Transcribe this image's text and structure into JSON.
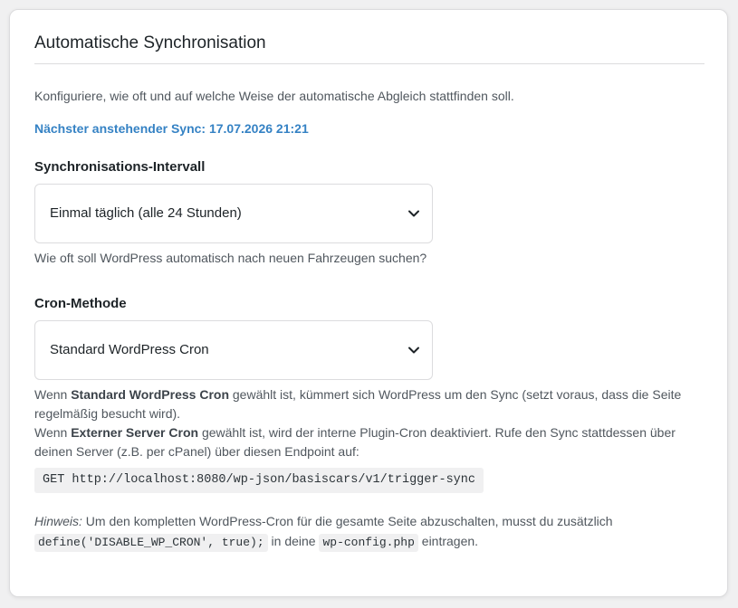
{
  "section": {
    "title": "Automatische Synchronisation",
    "intro": "Konfiguriere, wie oft und auf welche Weise der automatische Abgleich stattfinden soll.",
    "next_sync_label": "Nächster anstehender Sync:",
    "next_sync_value": "17.07.2026 21:21"
  },
  "interval": {
    "label": "Synchronisations-Intervall",
    "selected": "Einmal täglich (alle 24 Stunden)",
    "help": "Wie oft soll WordPress automatisch nach neuen Fahrzeugen suchen?"
  },
  "cron": {
    "label": "Cron-Methode",
    "selected": "Standard WordPress Cron",
    "help1_prefix": "Wenn",
    "help1_strong": "Standard WordPress Cron",
    "help1_suffix": "gewählt ist, kümmert sich WordPress um den Sync (setzt voraus, dass die Seite regelmäßig besucht wird).",
    "help2_prefix": "Wenn",
    "help2_strong": "Externer Server Cron",
    "help2_suffix": "gewählt ist, wird der interne Plugin-Cron deaktiviert. Rufe den Sync stattdessen über deinen Server (z.B. per cPanel) über diesen Endpoint auf:",
    "endpoint": "GET http://localhost:8080/wp-json/basiscars/v1/trigger-sync"
  },
  "hint": {
    "label": "Hinweis:",
    "text1": "Um den kompletten WordPress-Cron für die gesamte Seite abzuschalten, musst du zusätzlich",
    "code1": "define('DISABLE_WP_CRON', true);",
    "text2": "in deine",
    "code2": "wp-config.php",
    "text3": "eintragen."
  },
  "icons": {
    "select_arrow": "chevron-down-icon"
  },
  "colors": {
    "accent": "#3582c4",
    "text": "#50575e",
    "border": "#dcdcde",
    "code_bg": "#f0f0f1"
  }
}
